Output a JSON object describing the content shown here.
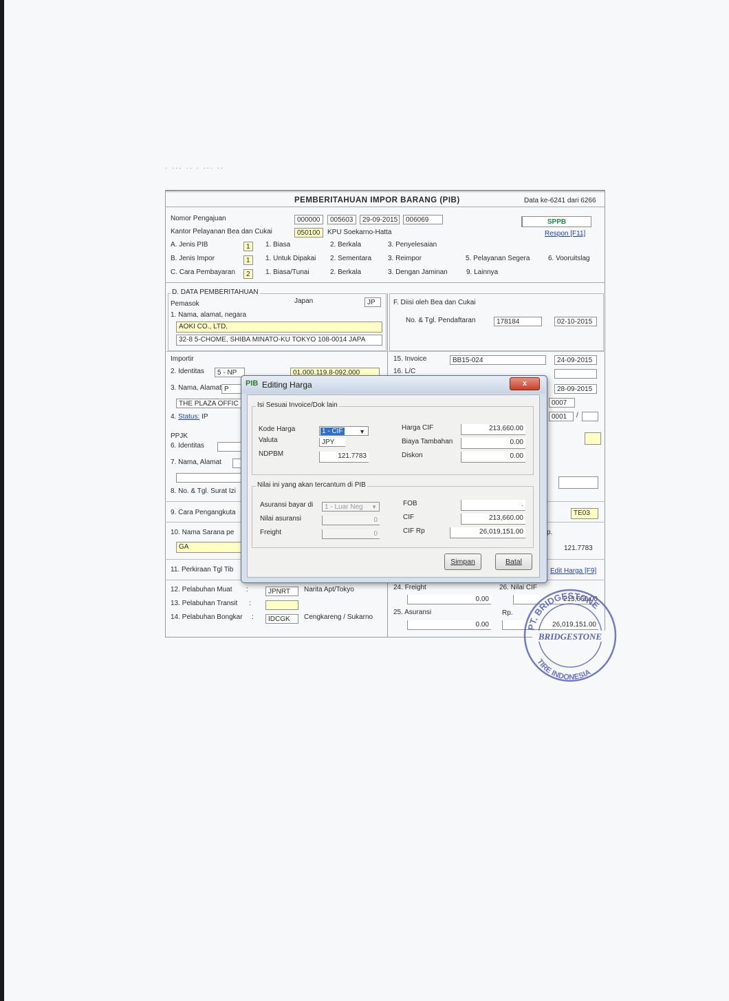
{
  "header": {
    "blurred_text": ".  ...   ..   .  ...  ..",
    "title": "PEMBERITAHUAN IMPOR BARANG (PIB)",
    "record": "Data ke-6241 dari 6266"
  },
  "top": {
    "nomor_label": "Nomor Pengajuan",
    "nomor_1": "000000",
    "nomor_2": "005603",
    "nomor_date": "29-09-2015",
    "nomor_4": "006069",
    "kantor_label": "Kantor Pelayanan Bea dan Cukai",
    "kantor_code": "050100",
    "kantor_name": "KPU Soekarno-Hatta",
    "status": "SPPB",
    "respon": "Respon [F11]"
  },
  "jenis_pib": {
    "label": "A. Jenis PIB",
    "value": "1",
    "options": [
      "1. Biasa",
      "2. Berkala",
      "3. Penyelesaian"
    ]
  },
  "jenis_impor": {
    "label": "B. Jenis Impor",
    "value": "1",
    "options": [
      "1. Untuk Dipakai",
      "2. Sementara",
      "3. Reimpor",
      "5. Pelayanan Segera",
      "6. Vooruitslag"
    ]
  },
  "cara_bayar": {
    "label": "C. Cara Pembayaran",
    "value": "2",
    "options": [
      "1. Biasa/Tunai",
      "2. Berkala",
      "3. Dengan Jaminan",
      "9. Lainnya"
    ]
  },
  "data_pemberitahuan": {
    "legend": "D. DATA PEMBERITAHUAN",
    "pemasok": "Pemasok",
    "negara": "Japan",
    "negara_code": "JP",
    "nama_label": "1. Nama, alamat, negara",
    "nama": "AOKI CO., LTD.",
    "alamat": "32-8 5-CHOME, SHIBA MINATO-KU TOKYO 108-0014 JAPA",
    "importir": "Importir",
    "identitas_label": "2. Identitas",
    "identitas_type": "5 - NP",
    "identitas_no": "01.000.119.8-092.000",
    "nama_alamat_label": "3. Nama, Alamat",
    "nama_alamat_value": "P",
    "importir_addr": "THE PLAZA OFFIC",
    "status_prefix": "4. ",
    "status_link": "Status:",
    "status_value": "IP",
    "ppjk": "PPJK",
    "ppjk_identitas": "6. Identitas",
    "ppjk_nama": "7. Nama, Alamat",
    "surat_izin": "8. No. & Tgl. Surat Izi",
    "cara_angkut": "9. Cara Pengangkuta",
    "sarana_label": "10. Nama Sarana pe",
    "sarana_value": "GA",
    "perkiraan": "11. Perkiraan Tgl Tib",
    "muat_label": "12. Pelabuhan Muat",
    "muat_code": "JPNRT",
    "muat_name": "Narita Apt/Tokyo",
    "transit_label": "13. Pelabuhan Transit",
    "bongkar_label": "14. Pelabuhan Bongkar",
    "bongkar_code": "IDCGK",
    "bongkar_name": "Cengkareng / Sukarno"
  },
  "bea_cukai": {
    "legend": "F. Diisi oleh Bea dan Cukai",
    "pendaftaran_label": "No. & Tgl. Pendaftaran",
    "pendaftaran_no": "178184",
    "pendaftaran_date": "02-10-2015"
  },
  "right_col": {
    "invoice_label": "15. Invoice",
    "invoice_no": "BB15-024",
    "invoice_date": "24-09-2015",
    "lc_label": "16. L/C",
    "date2": "28-09-2015",
    "v0007": "0007",
    "v0001": "0001",
    "slash": "/",
    "te03": "TE03",
    "rp_frag": "p.",
    "ndpbm": "121.7783",
    "edit_harga": "Edit Harga [F9]",
    "freight_label": "24. Freight",
    "freight_value": "0.00",
    "asuransi_label": "25. Asuransi",
    "asuransi_value": "0.00",
    "nilai_cif_label": "26. Nilai CIF",
    "nilai_cif_value": "213,660.00",
    "rp_label": "Rp.",
    "cif_rp_value": "26,019,151.00"
  },
  "dialog": {
    "app_icon": "PIB",
    "title": "Editing Harga",
    "close": "x",
    "group1": "Isi Sesuai Invoice/Dok lain",
    "kode_harga_label": "Kode Harga",
    "kode_harga_value": "1 - CIF",
    "valuta_label": "Valuta",
    "valuta_value": "JPY",
    "ndpbm_label": "NDPBM",
    "ndpbm_value": "121.7783",
    "harga_cif_label": "Harga CIF",
    "harga_cif_value": "213,660.00",
    "biaya_label": "Biaya Tambahan",
    "biaya_value": "0.00",
    "diskon_label": "Diskon",
    "diskon_value": "0.00",
    "group2": "Nilai ini yang akan tercantum di PIB",
    "asuransi_bayar_label": "Asuransi bayar di",
    "asuransi_bayar_value": "1 - Luar Neg",
    "nilai_asuransi_label": "Nilai asuransi",
    "nilai_asuransi_value": "0",
    "freight_label": "Freight",
    "freight_value": "0",
    "fob_label": "FOB",
    "fob_value": ".",
    "cif_label": "CIF",
    "cif_value": "213,660.00",
    "cifrp_label": "CIF Rp",
    "cifrp_value": "26,019,151.00",
    "simpan": "Simpan",
    "batal": "Batal"
  },
  "stamp": {
    "text_top": "PT. BRIDGESTONE",
    "text_mid": "BRIDGESTONE",
    "text_bottom": "TIRE INDONESIA"
  },
  "colors": {
    "accent_green": "#1b8a45",
    "link_blue": "#1f3fa8",
    "field_yellow": "#ffffc4",
    "stamp_blue": "#5a63b8"
  }
}
